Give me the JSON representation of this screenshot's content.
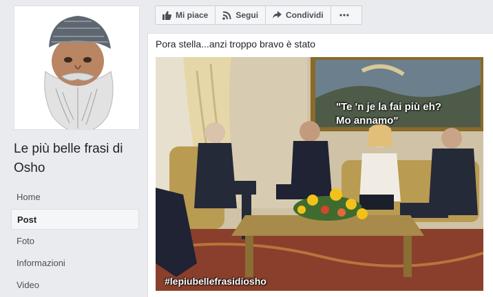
{
  "page": {
    "name": "Le più belle frasi di Osho"
  },
  "nav": {
    "items": [
      {
        "label": "Home"
      },
      {
        "label": "Post"
      },
      {
        "label": "Foto"
      },
      {
        "label": "Informazioni"
      },
      {
        "label": "Video"
      }
    ]
  },
  "actions": {
    "like": "Mi piace",
    "follow": "Segui",
    "share": "Condividi",
    "more_icon": "more-dots-icon"
  },
  "post": {
    "text": "Pora stella...anzi troppo bravo è stato",
    "image": {
      "caption_line1": "\"Te 'n je la fai più eh?",
      "caption_line2": "Mo annamo\"",
      "hashtag": "#lepiubellefrasidiosho"
    }
  },
  "colors": {
    "background": "#e9ebee",
    "card": "#ffffff",
    "border": "#dddfe2",
    "text": "#1d2129",
    "muted": "#4b4f56"
  }
}
